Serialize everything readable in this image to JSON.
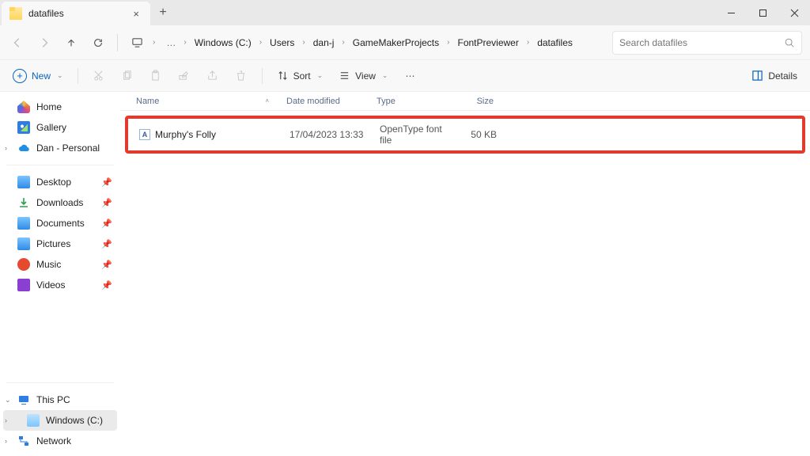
{
  "tab": {
    "title": "datafiles"
  },
  "breadcrumbs": [
    "Windows (C:)",
    "Users",
    "dan-j",
    "GameMakerProjects",
    "FontPreviewer",
    "datafiles"
  ],
  "search": {
    "placeholder": "Search datafiles"
  },
  "toolbar": {
    "new": "New",
    "sort": "Sort",
    "view": "View",
    "details": "Details"
  },
  "columns": {
    "name": "Name",
    "date": "Date modified",
    "type": "Type",
    "size": "Size"
  },
  "files": [
    {
      "name": "Murphy's Folly",
      "date": "17/04/2023 13:33",
      "type": "OpenType font file",
      "size": "50 KB"
    }
  ],
  "sidebar": {
    "home": "Home",
    "gallery": "Gallery",
    "personal": "Dan - Personal",
    "desktop": "Desktop",
    "downloads": "Downloads",
    "documents": "Documents",
    "pictures": "Pictures",
    "music": "Music",
    "videos": "Videos",
    "thispc": "This PC",
    "cdrive": "Windows (C:)",
    "network": "Network"
  }
}
